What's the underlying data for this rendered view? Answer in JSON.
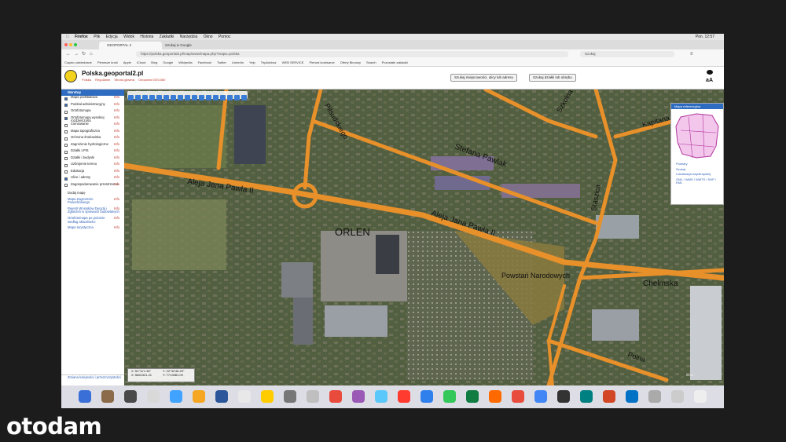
{
  "menubar": {
    "items": [
      "Firefox",
      "Plik",
      "Edycja",
      "Widok",
      "Historia",
      "Zakładki",
      "Narzędzia",
      "Okno",
      "Pomoc"
    ],
    "clock": "Pon. 12:57"
  },
  "tabs": [
    {
      "label": "GEOPORTAL 2"
    },
    {
      "label": "Szukaj w Google"
    }
  ],
  "url": {
    "value": "https://polska.geoportal2.pl/map/www/mapa.php?mapa=polska",
    "search_placeholder": "Szukaj"
  },
  "bookmarks": [
    "Często odwiedzane",
    "Pierwsze kroki",
    "Apple",
    "iCloud",
    "Bing",
    "Google",
    "Wikipedia",
    "Facebook",
    "Twitter",
    "LinkedIn",
    "Yelp",
    "TripAdvisor",
    "WEB SERVICE",
    "Pierwsi komisarze",
    "Oferty Biurowy",
    "Search",
    "Pozostałe zakładki"
  ],
  "header": {
    "title": "Polska.geoportal2.pl",
    "links": [
      "Polska",
      "Regulamin",
      "Strona główna",
      "Geoportal GEO360"
    ],
    "search_address_btn": "Szukaj miejscowości, ulicy lub adresu",
    "search_parcel_btn": "Szukaj działki lub obrębu",
    "font_toggle": "aA"
  },
  "sidebar": {
    "header": "Warstwy",
    "layers": [
      {
        "label": "Mapa podkładowa",
        "checked": true
      },
      {
        "label": "Podział administracyjny",
        "checked": true
      },
      {
        "label": "Ortofotomapa",
        "checked": false
      },
      {
        "label": "Ortofotomapa wysokiej rozdzielczości",
        "checked": true
      },
      {
        "label": "Cieniowanie",
        "checked": false
      },
      {
        "label": "Mapa topograficzna",
        "checked": false
      },
      {
        "label": "Ochrona środowiska",
        "checked": false
      },
      {
        "label": "Zagrożenie hydrologiczne",
        "checked": false
      },
      {
        "label": "Działki LPIS",
        "checked": false
      },
      {
        "label": "Działki i budynki",
        "checked": false
      },
      {
        "label": "Uzbrojenie terenu",
        "checked": false
      },
      {
        "label": "Edukacja",
        "checked": false
      },
      {
        "label": "Ulice i adresy",
        "checked": true
      },
      {
        "label": "Zagospodarowanie przestrzenne",
        "checked": false
      }
    ],
    "info_label": "Info",
    "section": "Dodaj mapę",
    "links": [
      {
        "label": "Mapa Zagrożenie Powodziowego"
      },
      {
        "label": "Rejestr Wniosków Decyzji i Zgłoszeń w sprawach budowlanych"
      },
      {
        "label": "Ortofotomapa po pożarze według aktualności"
      },
      {
        "label": "Mapa turystyczna"
      }
    ],
    "footer": "Zmiana kolejności i przezroczystości"
  },
  "map": {
    "labels": {
      "street1": "Aleja Jana Pawła II",
      "street2": "Aleja Jana Pawła II",
      "street3": "Stefana Pawlak",
      "street4": "Staszica",
      "street5": "Chełmska",
      "street6": "Kapitana",
      "street7": "Szkolna",
      "street8": "Piłsudskiego",
      "street9": "Polna",
      "orlen": "ORLEN",
      "park": "Powstań Narodowych"
    },
    "overview_header": "Mapa referencyjna",
    "overview_items": [
      "Pomiary",
      "Szukaj",
      "Lokalizacja współrzędnej",
      "GML / WMS / WMTS / SHP / KML"
    ],
    "coords": {
      "line1": "X: 51°11'1.34\"",
      "line2": "Y: 22°42'46.29\"",
      "line3": "X: 5661321.21",
      "line4": "Y: 7713981.09"
    },
    "scale": "20 m"
  },
  "dock": {
    "colors": [
      "#3a6fd8",
      "#8b6b4a",
      "#4a4a4a",
      "#d9d9d9",
      "#3fa3ff",
      "#f5a623",
      "#2b579a",
      "#e8e8e8",
      "#ffcc00",
      "#777777",
      "#bfbfbf",
      "#e84a3c",
      "#9b59b6",
      "#5ac8fa",
      "#ff3b30",
      "#2f80ed",
      "#34c759",
      "#107c41",
      "#ff6a00",
      "#e74c3c",
      "#4285f4",
      "#333333",
      "#008080",
      "#d24726",
      "#0072c6",
      "#aaaaaa",
      "#cccccc",
      "#eeeeee"
    ]
  },
  "watermark": "otodam"
}
